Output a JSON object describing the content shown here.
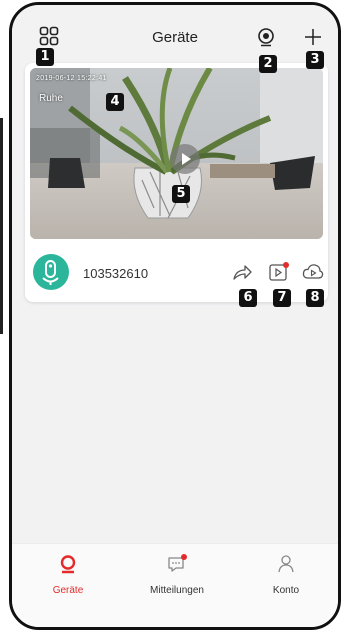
{
  "header": {
    "title": "Geräte",
    "left_icon": "grid-icon",
    "camera_icon": "camera-scan-icon",
    "add_icon": "plus-icon"
  },
  "callouts": [
    "1",
    "2",
    "3",
    "4",
    "5",
    "6",
    "7",
    "8"
  ],
  "device_card": {
    "timestamp": "2019-06-12 15:22:41",
    "mode_label": "Ruhe",
    "device_id": "103532610",
    "actions": [
      "share-icon",
      "playback-icon",
      "cloud-playback-icon"
    ]
  },
  "tabs": [
    {
      "label": "Geräte",
      "icon": "camera-tab-icon",
      "active": true
    },
    {
      "label": "Mitteilungen",
      "icon": "message-icon",
      "active": false,
      "has_dot": true
    },
    {
      "label": "Konto",
      "icon": "person-icon",
      "active": false
    }
  ],
  "colors": {
    "accent": "#e32b2b",
    "avatar": "#2bb59a",
    "background": "#f2f2f3"
  }
}
